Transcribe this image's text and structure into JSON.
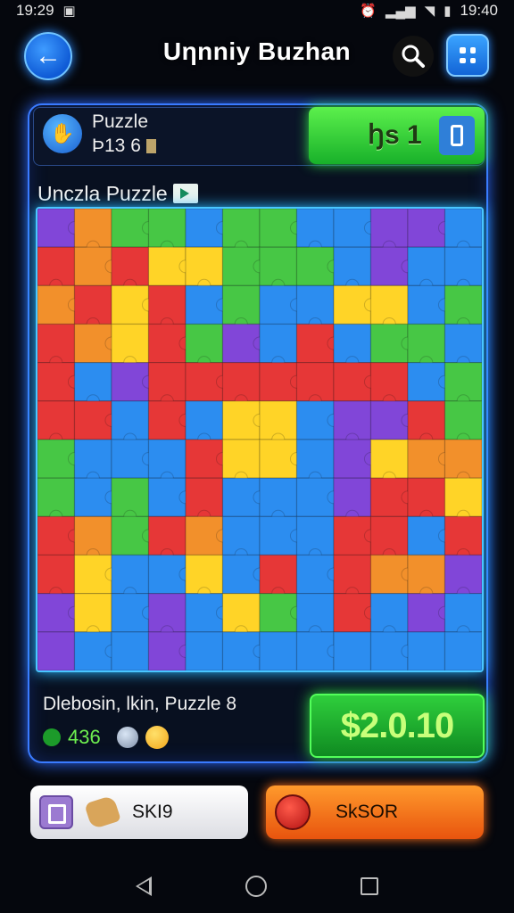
{
  "status_bar": {
    "time_left": "19:29",
    "time_right": "19:40"
  },
  "header": {
    "title": "Uηnniy Buzhan",
    "back_icon": "arrow-left-icon",
    "search_icon": "search-icon",
    "menu_icon": "grid-menu-icon"
  },
  "info": {
    "title": "Puzzle",
    "subtitle": "Ϸ13 6",
    "score_label": "ꜧs 1"
  },
  "section": {
    "label": "Unczla Puzzle"
  },
  "board": {
    "cols": 12,
    "rows": 12,
    "colors": [
      "#e52b2b",
      "#f28a1e",
      "#ffd21a",
      "#3cc43a",
      "#1f86f0",
      "#7a3bd6"
    ],
    "grid": [
      [
        5,
        1,
        3,
        3,
        4,
        3,
        3,
        4,
        4,
        5,
        5,
        4
      ],
      [
        0,
        1,
        0,
        2,
        2,
        3,
        3,
        3,
        4,
        5,
        4,
        4
      ],
      [
        1,
        0,
        2,
        0,
        4,
        3,
        4,
        4,
        2,
        2,
        4,
        3
      ],
      [
        0,
        1,
        2,
        0,
        3,
        5,
        4,
        0,
        4,
        3,
        3,
        4
      ],
      [
        0,
        4,
        5,
        0,
        0,
        0,
        0,
        0,
        0,
        0,
        4,
        3
      ],
      [
        0,
        0,
        4,
        0,
        4,
        2,
        2,
        4,
        5,
        5,
        0,
        3
      ],
      [
        3,
        4,
        4,
        4,
        0,
        2,
        2,
        4,
        5,
        2,
        1,
        1
      ],
      [
        3,
        4,
        3,
        4,
        0,
        4,
        4,
        4,
        5,
        0,
        0,
        2
      ],
      [
        0,
        1,
        3,
        0,
        1,
        4,
        4,
        4,
        0,
        0,
        4,
        0
      ],
      [
        0,
        2,
        4,
        4,
        2,
        4,
        0,
        4,
        0,
        1,
        1,
        5
      ],
      [
        5,
        2,
        4,
        5,
        4,
        2,
        3,
        4,
        0,
        4,
        5,
        4
      ],
      [
        5,
        4,
        4,
        5,
        4,
        4,
        4,
        4,
        4,
        4,
        4,
        4
      ]
    ]
  },
  "bottom": {
    "text": "Dlebosin, lkin, Puzzle 8",
    "stat": "436",
    "price": "$2.0.10"
  },
  "actions": {
    "skip_label": "SKI9",
    "go_label": "SkSOR"
  }
}
